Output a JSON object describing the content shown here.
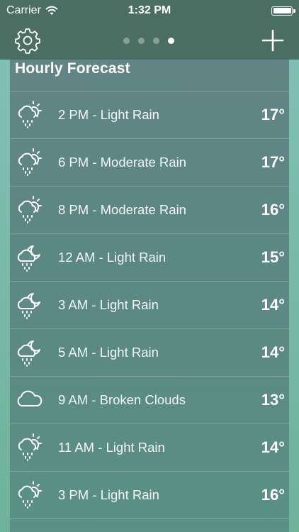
{
  "status_bar": {
    "carrier": "Carrier",
    "time": "1:32 PM"
  },
  "nav": {
    "settings_icon": "gear-icon",
    "add_icon": "plus-icon",
    "page_dots": 4,
    "active_page": 4
  },
  "forecast": {
    "title": "Hourly Forecast",
    "rows": [
      {
        "label": "2 PM - Light Rain",
        "temp": "17°",
        "icon": "sun-rain-icon"
      },
      {
        "label": "6 PM - Moderate Rain",
        "temp": "17°",
        "icon": "sun-rain-icon"
      },
      {
        "label": "8 PM - Moderate Rain",
        "temp": "16°",
        "icon": "sun-rain-icon"
      },
      {
        "label": "12 AM - Light Rain",
        "temp": "15°",
        "icon": "moon-rain-icon"
      },
      {
        "label": "3 AM - Light Rain",
        "temp": "14°",
        "icon": "moon-rain-icon"
      },
      {
        "label": "5 AM - Light Rain",
        "temp": "14°",
        "icon": "moon-rain-icon"
      },
      {
        "label": "9 AM - Broken Clouds",
        "temp": "13°",
        "icon": "cloud-icon"
      },
      {
        "label": "11 AM - Light Rain",
        "temp": "14°",
        "icon": "sun-rain-icon"
      },
      {
        "label": "3 PM - Light Rain",
        "temp": "16°",
        "icon": "sun-rain-icon"
      }
    ]
  },
  "colors": {
    "bar": "#4b6e63",
    "side": "#7fc0b2"
  }
}
